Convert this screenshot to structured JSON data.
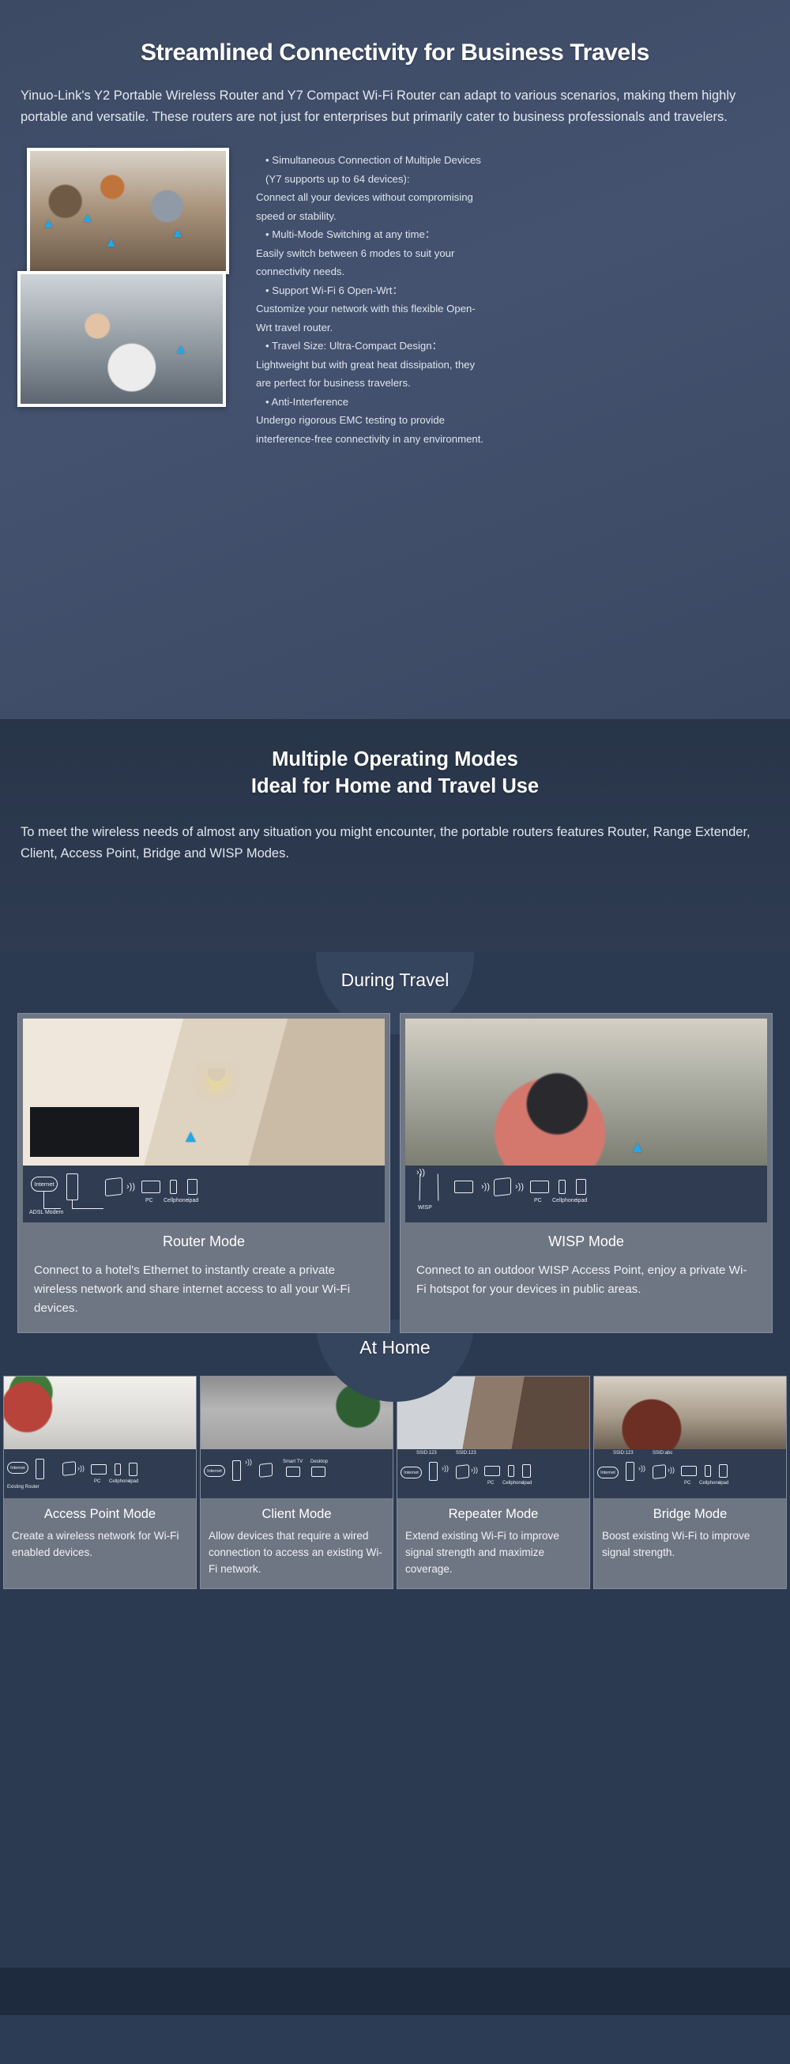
{
  "hero": {
    "title": "Streamlined Connectivity for Business Travels",
    "intro": "Yinuo-Link's Y2 Portable Wireless Router and Y7 Compact Wi-Fi Router can adapt to various scenarios, making them highly portable and versatile. These routers are not just for enterprises but primarily cater to business professionals and travelers.",
    "features": [
      "• Simultaneous Connection of Multiple Devices",
      " (Y7 supports up to 64 devices):",
      "Connect all your devices without compromising",
      "speed or stability.",
      "• Multi-Mode Switching at any time：",
      "Easily switch between 6 modes to suit your",
      "connectivity needs.",
      "• Support Wi-Fi 6 Open-Wrt：",
      "Customize your network with this flexible Open-",
      "Wrt travel router.",
      "• Travel Size: Ultra-Compact Design：",
      "Lightweight but with great heat dissipation, they",
      "are perfect for business travelers.",
      "• Anti-Interference",
      "Undergo rigorous EMC testing to provide",
      "interference-free connectivity in any environment."
    ]
  },
  "modes": {
    "title_line1": "Multiple Operating Modes",
    "title_line2": "Ideal for Home and Travel Use",
    "description": "To meet the wireless needs of almost any situation you might encounter, the portable routers features Router, Range Extender, Client, Access Point, Bridge and WISP Modes."
  },
  "travel": {
    "section_label": "During Travel",
    "cards": [
      {
        "title": "Router Mode",
        "text": "Connect to a hotel's Ethernet to instantly create a private wireless network and share internet access to all your Wi-Fi devices.",
        "diagram": {
          "cloud": "Internet",
          "source_label": "ADSL Modem",
          "devices": [
            "PC",
            "Cellphone",
            "ipad"
          ]
        }
      },
      {
        "title": "WISP Mode",
        "text": "Connect to an outdoor WISP Access Point, enjoy a private Wi-Fi hotspot for your devices in public areas.",
        "diagram": {
          "cloud": "",
          "source_label": "WISP",
          "devices": [
            "PC",
            "Cellphone",
            "ipad"
          ]
        }
      }
    ]
  },
  "athome": {
    "section_label": "At Home",
    "cards": [
      {
        "title": "Access Point Mode",
        "text": "Create a wireless network for Wi-Fi enabled devices.",
        "diagram": {
          "cloud": "Internet",
          "source_label": "Existing Router",
          "ssid_left": "",
          "ssid_right": "",
          "devices": [
            "PC",
            "Cellphone",
            "ipad"
          ]
        }
      },
      {
        "title": "Client Mode",
        "text": "Allow devices that require a wired connection to access an existing Wi-Fi network.",
        "diagram": {
          "cloud": "Internet",
          "source_label": "",
          "ssid_left": "",
          "ssid_right": "",
          "devices": [
            "Smart TV",
            "Desktop"
          ]
        }
      },
      {
        "title": "Repeater Mode",
        "text": "Extend existing Wi-Fi to improve signal strength and maximize coverage.",
        "diagram": {
          "cloud": "Internet",
          "source_label": "",
          "ssid_left": "SSID:123",
          "ssid_right": "SSID:123",
          "devices": [
            "PC",
            "Cellphone",
            "ipad"
          ]
        }
      },
      {
        "title": "Bridge Mode",
        "text": "Boost existing Wi-Fi to improve signal strength.",
        "diagram": {
          "cloud": "Internet",
          "source_label": "",
          "ssid_left": "SSID:123",
          "ssid_right": "SSID:abc",
          "devices": [
            "PC",
            "Cellphone",
            "ipad"
          ]
        }
      }
    ]
  },
  "colors": {
    "background": "#2d3c55",
    "hero_background": "#445270",
    "card_background": "#6e7683",
    "diagram_background": "#2f3c52",
    "wifi_accent": "#21a8e8",
    "text_primary": "#ffffff",
    "text_secondary": "#e2e7ee"
  }
}
